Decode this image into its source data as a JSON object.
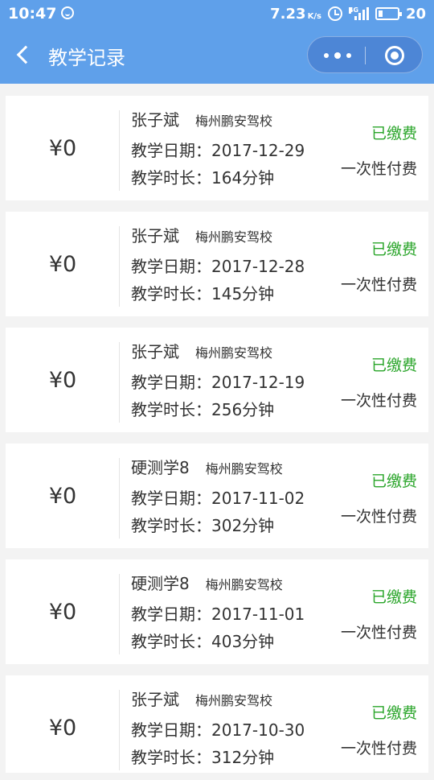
{
  "statusbar": {
    "time": "10:47",
    "speed": "7.23",
    "speed_unit": "K/s",
    "network": "4G",
    "battery": "20"
  },
  "navbar": {
    "title": "教学记录"
  },
  "records": [
    {
      "amount": "¥0",
      "student": "张子斌",
      "school": "梅州鹏安驾校",
      "date_label": "教学日期：",
      "date": "2017-12-29",
      "duration_label": "教学时长：",
      "duration": "164分钟",
      "status": "已缴费",
      "pay_type": "一次性付费"
    },
    {
      "amount": "¥0",
      "student": "张子斌",
      "school": "梅州鹏安驾校",
      "date_label": "教学日期：",
      "date": "2017-12-28",
      "duration_label": "教学时长：",
      "duration": "145分钟",
      "status": "已缴费",
      "pay_type": "一次性付费"
    },
    {
      "amount": "¥0",
      "student": "张子斌",
      "school": "梅州鹏安驾校",
      "date_label": "教学日期：",
      "date": "2017-12-19",
      "duration_label": "教学时长：",
      "duration": "256分钟",
      "status": "已缴费",
      "pay_type": "一次性付费"
    },
    {
      "amount": "¥0",
      "student": "硬测学8",
      "school": "梅州鹏安驾校",
      "date_label": "教学日期：",
      "date": "2017-11-02",
      "duration_label": "教学时长：",
      "duration": "302分钟",
      "status": "已缴费",
      "pay_type": "一次性付费"
    },
    {
      "amount": "¥0",
      "student": "硬测学8",
      "school": "梅州鹏安驾校",
      "date_label": "教学日期：",
      "date": "2017-11-01",
      "duration_label": "教学时长：",
      "duration": "403分钟",
      "status": "已缴费",
      "pay_type": "一次性付费"
    },
    {
      "amount": "¥0",
      "student": "张子斌",
      "school": "梅州鹏安驾校",
      "date_label": "教学日期：",
      "date": "2017-10-30",
      "duration_label": "教学时长：",
      "duration": "312分钟",
      "status": "已缴费",
      "pay_type": "一次性付费"
    }
  ],
  "colors": {
    "nav_background": "#5fa0ea",
    "status_paid": "#2aa52a",
    "page_background": "#f3f3f3"
  }
}
